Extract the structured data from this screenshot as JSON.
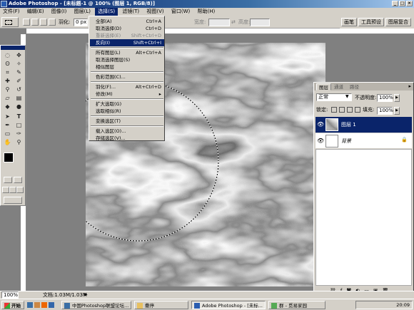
{
  "window": {
    "title": "Adobe Photoshop - [未标题-1 @ 100% (图层 1, RGB/8)]"
  },
  "menu": [
    {
      "label": "文件(F)"
    },
    {
      "label": "编辑(E)"
    },
    {
      "label": "图像(I)"
    },
    {
      "label": "图层(L)"
    },
    {
      "label": "选择(S)"
    },
    {
      "label": "滤镜(T)"
    },
    {
      "label": "视图(V)"
    },
    {
      "label": "窗口(W)"
    },
    {
      "label": "帮助(H)"
    }
  ],
  "options": {
    "feather_label": "羽化:",
    "feather_value": "0 px",
    "width_label": "宽度:",
    "height_label": "高度:",
    "palette_tabs": [
      "画笔",
      "工具预设",
      "图层复合"
    ]
  },
  "select_menu": {
    "items": [
      {
        "label": "全部(A)",
        "shortcut": "Ctrl+A",
        "disabled": false
      },
      {
        "label": "取消选择(D)",
        "shortcut": "Ctrl+D",
        "disabled": false
      },
      {
        "label": "重新选择(E)",
        "shortcut": "Shift+Ctrl+D",
        "disabled": true
      },
      {
        "label": "反向(I)",
        "shortcut": "Shift+Ctrl+I",
        "highlighted": true
      },
      {
        "label": "所有图层(L)",
        "shortcut": "Alt+Ctrl+A"
      },
      {
        "label": "取消选择图层(S)",
        "shortcut": ""
      },
      {
        "label": "相似图层",
        "shortcut": ""
      },
      {
        "label": "色彩范围(C)...",
        "shortcut": ""
      },
      {
        "label": "羽化(F)...",
        "shortcut": "Alt+Ctrl+D"
      },
      {
        "label": "修改(M)",
        "shortcut": "▸"
      },
      {
        "label": "扩大选取(G)",
        "shortcut": ""
      },
      {
        "label": "选取相似(R)",
        "shortcut": ""
      },
      {
        "label": "变换选区(T)",
        "shortcut": ""
      },
      {
        "label": "载入选区(O)...",
        "shortcut": ""
      },
      {
        "label": "存储选区(V)...",
        "shortcut": ""
      }
    ]
  },
  "layers_panel": {
    "tabs": [
      "图层",
      "通道",
      "路径"
    ],
    "blend_mode": "正常",
    "opacity_label": "不透明度:",
    "opacity_value": "100%",
    "lock_label": "锁定:",
    "fill_label": "填充:",
    "fill_value": "100%",
    "layers": [
      {
        "name": "图层 1",
        "selected": true
      },
      {
        "name": "背景",
        "selected": false
      }
    ]
  },
  "status": {
    "zoom": "100%",
    "doc_info": "文档:1.03M/1.03M"
  },
  "taskbar": {
    "start": "开始",
    "tasks": [
      "中国Photoshop联盟论坛...",
      "撒停",
      "Adobe Photoshop - [未标...",
      "群 - 觅易家园"
    ],
    "clock": "20:09"
  },
  "colors": {
    "accent": "#0a246a",
    "chrome": "#d4d0c8",
    "selection_marquee": "#ffffff"
  }
}
